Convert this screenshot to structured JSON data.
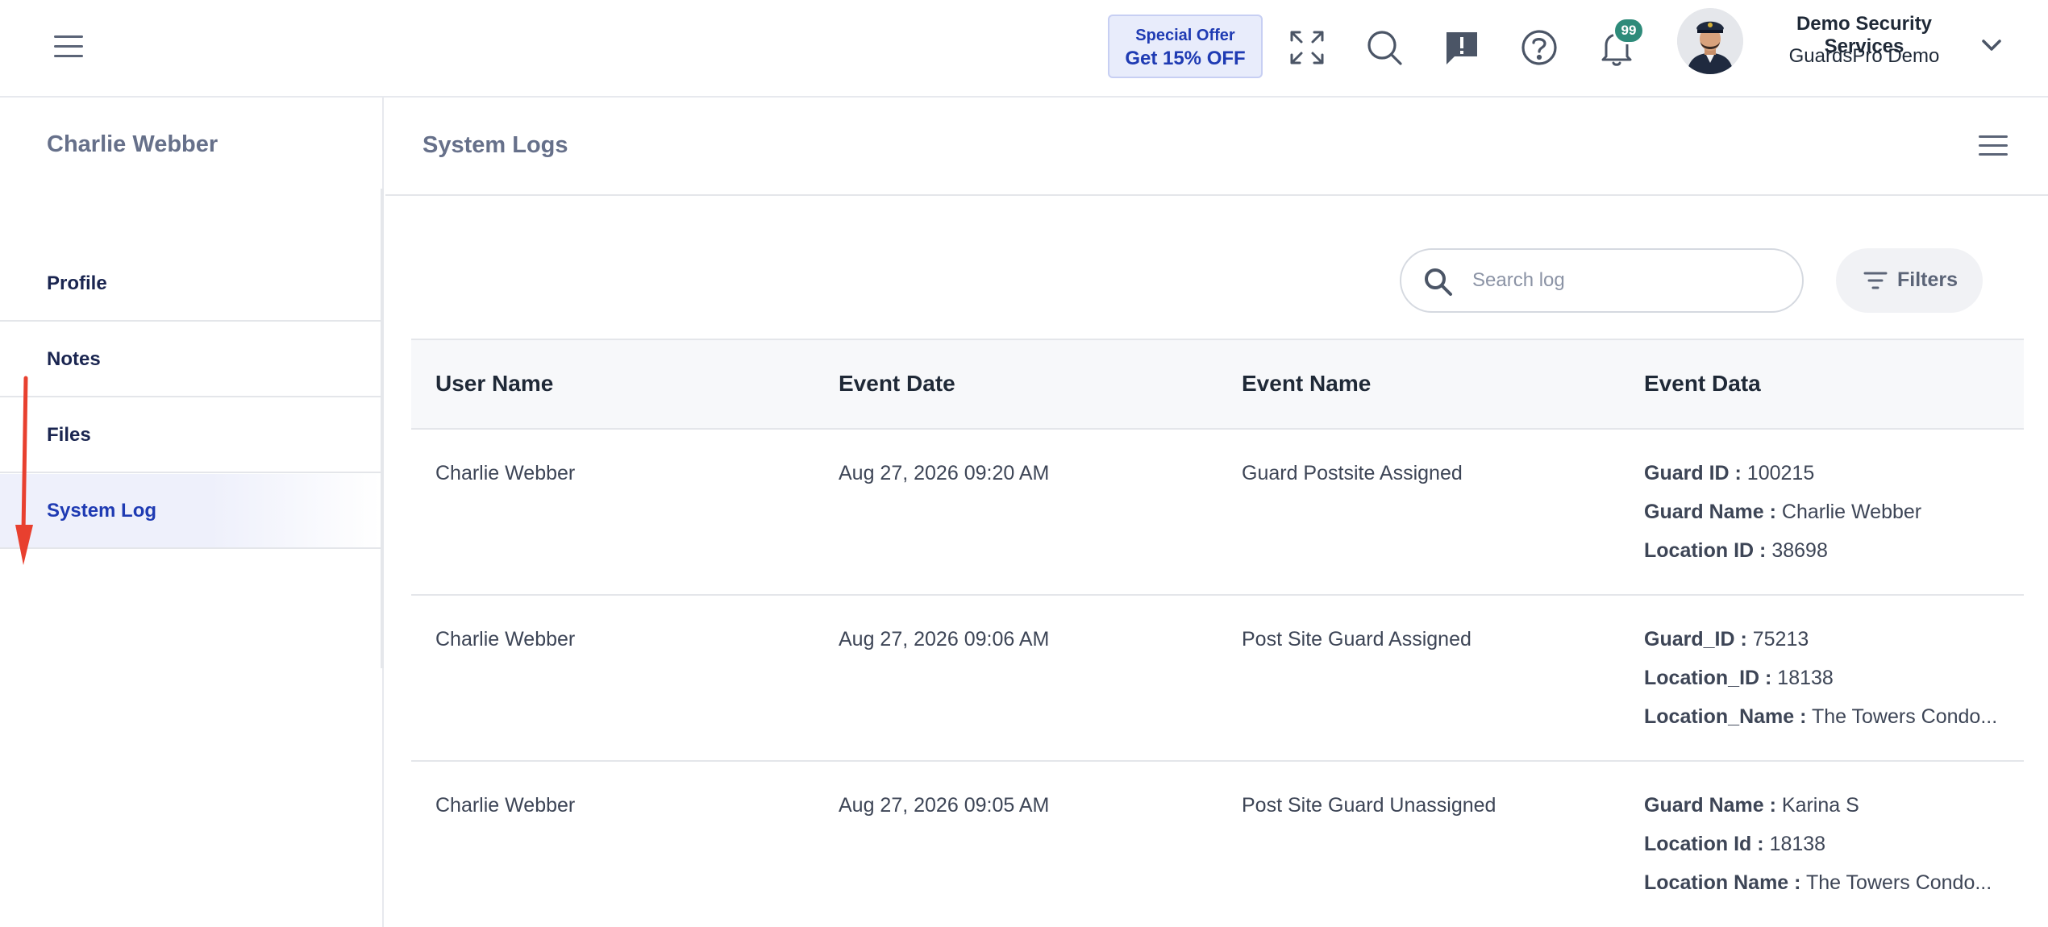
{
  "topbar": {
    "offer_line1": "Special Offer",
    "offer_line2": "Get 15% OFF",
    "notification_count": "99",
    "company_name": "Demo Security Services",
    "account_name": "GuardsPro Demo",
    "icons": [
      "menu-icon",
      "expand-icon",
      "search-icon",
      "feedback-icon",
      "help-icon",
      "bell-icon",
      "chevron-down-icon"
    ]
  },
  "sidebar": {
    "title": "Charlie Webber",
    "items": [
      {
        "label": "Profile"
      },
      {
        "label": "Notes"
      },
      {
        "label": "Files"
      },
      {
        "label": "System Log",
        "active": true
      }
    ]
  },
  "main": {
    "title": "System Logs",
    "search_placeholder": "Search log",
    "filters_label": "Filters",
    "columns": [
      "User Name",
      "Event Date",
      "Event Name",
      "Event Data"
    ],
    "rows": [
      {
        "user": "Charlie Webber",
        "date": "Aug 27, 2026 09:20 AM",
        "event": "Guard Postsite Assigned",
        "data": [
          {
            "key": "Guard ID :",
            "value": "100215"
          },
          {
            "key": "Guard Name :",
            "value": "Charlie Webber"
          },
          {
            "key": "Location ID :",
            "value": "38698"
          }
        ]
      },
      {
        "user": "Charlie Webber",
        "date": "Aug 27, 2026 09:06 AM",
        "event": "Post Site Guard Assigned",
        "data": [
          {
            "key": "Guard_ID :",
            "value": "75213"
          },
          {
            "key": "Location_ID :",
            "value": "18138"
          },
          {
            "key": "Location_Name :",
            "value": "The Towers Condo..."
          }
        ]
      },
      {
        "user": "Charlie Webber",
        "date": "Aug 27, 2026 09:05 AM",
        "event": "Post Site Guard Unassigned",
        "data": [
          {
            "key": "Guard Name :",
            "value": "Karina S"
          },
          {
            "key": "Location Id :",
            "value": "18138"
          },
          {
            "key": "Location Name :",
            "value": "The Towers Condo..."
          }
        ]
      }
    ]
  },
  "colors": {
    "accent": "#1f3bb3",
    "badge": "#2e8b7a",
    "annotation_arrow": "#e8402f"
  }
}
